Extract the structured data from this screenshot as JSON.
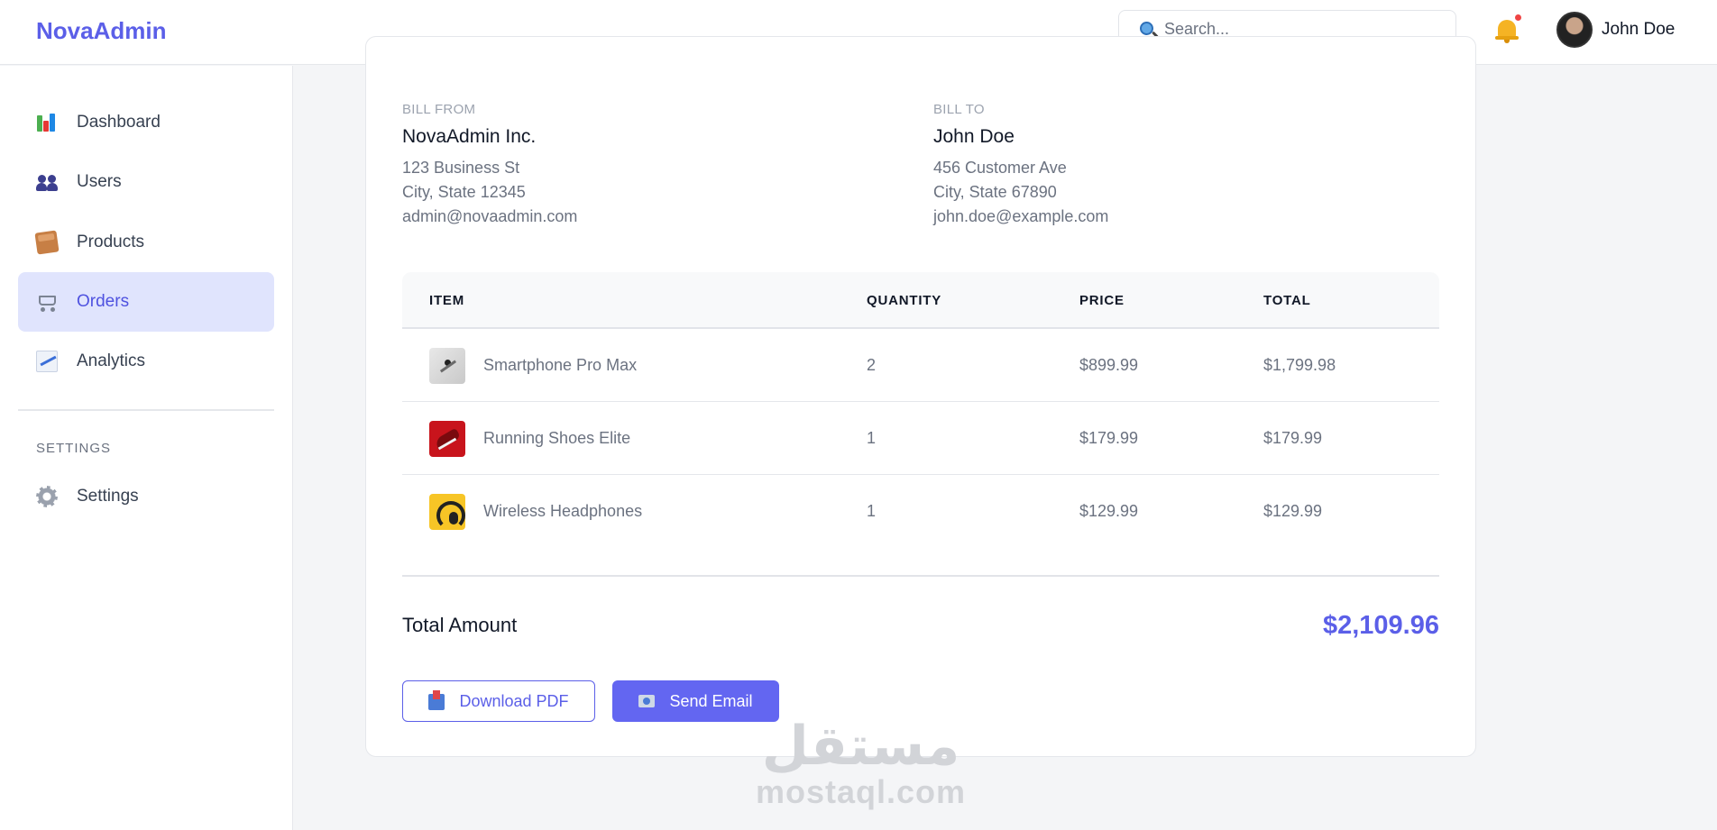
{
  "header": {
    "logo": "NovaAdmin",
    "search_placeholder": "Search...",
    "user_name": "John Doe",
    "notification_dot_color": "#ef4444"
  },
  "sidebar": {
    "items": [
      {
        "label": "Dashboard",
        "icon": "bar-chart-icon"
      },
      {
        "label": "Users",
        "icon": "users-icon"
      },
      {
        "label": "Products",
        "icon": "box-icon"
      },
      {
        "label": "Orders",
        "icon": "cart-icon",
        "active": true
      },
      {
        "label": "Analytics",
        "icon": "trend-chart-icon"
      }
    ],
    "section_label": "SETTINGS",
    "settings_item": {
      "label": "Settings",
      "icon": "gear-icon"
    }
  },
  "invoice": {
    "bill_from": {
      "label": "BILL FROM",
      "name": "NovaAdmin Inc.",
      "lines": [
        "123 Business St",
        "City, State 12345",
        "admin@novaadmin.com"
      ]
    },
    "bill_to": {
      "label": "BILL TO",
      "name": "John Doe",
      "lines": [
        "456 Customer Ave",
        "City, State 67890",
        "john.doe@example.com"
      ]
    },
    "columns": [
      "ITEM",
      "QUANTITY",
      "PRICE",
      "TOTAL"
    ],
    "rows": [
      {
        "item": "Smartphone Pro Max",
        "quantity": "2",
        "price": "$899.99",
        "total": "$1,799.98",
        "thumb": "phone"
      },
      {
        "item": "Running Shoes Elite",
        "quantity": "1",
        "price": "$179.99",
        "total": "$179.99",
        "thumb": "shoe"
      },
      {
        "item": "Wireless Headphones",
        "quantity": "1",
        "price": "$129.99",
        "total": "$129.99",
        "thumb": "headphones"
      }
    ],
    "total_label": "Total Amount",
    "total_value": "$2,109.96",
    "actions": {
      "download": "Download PDF",
      "email": "Send Email"
    }
  },
  "watermark": {
    "arabic": "مستقل",
    "latin": "mostaql.com"
  },
  "colors": {
    "accent": "#5b5fe8",
    "active_bg": "#e0e4fd",
    "button": "#6366f1"
  }
}
